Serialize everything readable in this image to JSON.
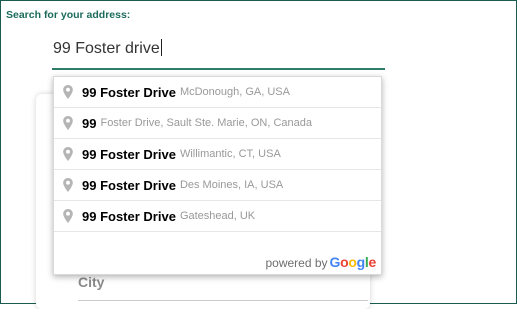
{
  "search": {
    "label": "Search for your address:",
    "value": "99 Foster drive"
  },
  "suggestions": [
    {
      "main": "99 Foster Drive",
      "secondary": "McDonough, GA, USA"
    },
    {
      "main": "99",
      "secondary": "Foster Drive, Sault Ste. Marie, ON, Canada"
    },
    {
      "main": "99 Foster Drive",
      "secondary": "Willimantic, CT, USA"
    },
    {
      "main": "99 Foster Drive",
      "secondary": "Des Moines, IA, USA"
    },
    {
      "main": "99 Foster Drive",
      "secondary": "Gateshead, UK"
    }
  ],
  "attribution": {
    "powered_by": "powered by",
    "brand": [
      "G",
      "o",
      "o",
      "g",
      "l",
      "e"
    ],
    "brand_colors": [
      "#4285F4",
      "#EA4335",
      "#FBBC05",
      "#4285F4",
      "#34A853",
      "#EA4335"
    ]
  },
  "form": {
    "city_label": "City"
  },
  "icons": {
    "suggestion_icon": "map-pin-icon"
  },
  "colors": {
    "accent": "#1b6b5c",
    "underline": "#2f7d68",
    "pin": "#b5b5b5"
  }
}
